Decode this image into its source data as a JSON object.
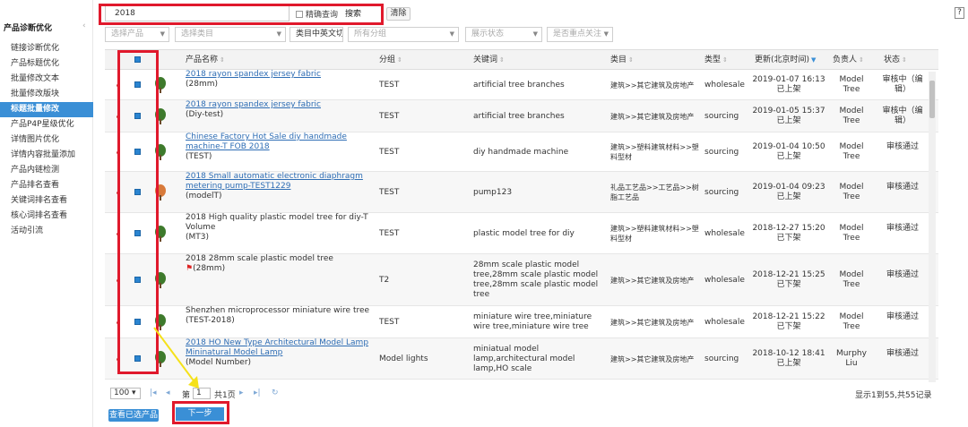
{
  "sidebar": {
    "title": "产品诊断优化",
    "collapse_icon": "chevron-left-icon",
    "items": [
      {
        "label": "链接诊断优化",
        "active": false
      },
      {
        "label": "产品标题优化",
        "active": false
      },
      {
        "label": "批量修改文本",
        "active": false
      },
      {
        "label": "批量修改版块",
        "active": false
      },
      {
        "label": "标题批量修改",
        "active": true
      },
      {
        "label": "产品P4P星级优化",
        "active": false
      },
      {
        "label": "详情图片优化",
        "active": false
      },
      {
        "label": "详情内容批量添加",
        "active": false
      },
      {
        "label": "产品内链检测",
        "active": false
      },
      {
        "label": "产品排名查看",
        "active": false
      },
      {
        "label": "关键词排名查看",
        "active": false
      },
      {
        "label": "核心词排名查看",
        "active": false
      },
      {
        "label": "活动引流",
        "active": false
      }
    ]
  },
  "search": {
    "value": "2018",
    "exact_label": "精确查询",
    "search_label": "搜索",
    "clear_label": "清除"
  },
  "help_label": "?",
  "filters": {
    "product": "选择产品",
    "category": "选择类目",
    "cut_label": "类目中英文切换",
    "group": "所有分组",
    "display": "展示状态",
    "focus": "是否重点关注"
  },
  "table": {
    "headers": {
      "name": "产品名称",
      "group": "分组",
      "keyword": "关键词",
      "category": "类目",
      "type": "类型",
      "updated": "更新(北京时间)",
      "owner": "负责人",
      "status": "状态"
    },
    "rows": [
      {
        "name": "2018 rayon spandex jersey fabric",
        "sub": "(28mm)",
        "link": true,
        "group": "TEST",
        "keyword": "artificial tree branches",
        "category": "建筑>>其它建筑及房地产",
        "type": "wholesale",
        "updated_date": "2019-01-07 16:13",
        "updated_state": "已上架",
        "owner": "Model Tree",
        "status": "审核中（编辑）"
      },
      {
        "name": "2018 rayon spandex jersey fabric",
        "sub": "(Diy-test)",
        "link": true,
        "group": "TEST",
        "keyword": "artificial tree branches",
        "category": "建筑>>其它建筑及房地产",
        "type": "sourcing",
        "updated_date": "2019-01-05 15:37",
        "updated_state": "已上架",
        "owner": "Model Tree",
        "status": "审核中（编辑）"
      },
      {
        "name": "Chinese Factory Hot Sale diy handmade machine-T FOB 2018",
        "sub": "(TEST)",
        "link": true,
        "group": "TEST",
        "keyword": "diy handmade machine",
        "category": "建筑>>塑料建筑材料>>塑料型材",
        "type": "sourcing",
        "updated_date": "2019-01-04 10:50",
        "updated_state": "已上架",
        "owner": "Model Tree",
        "status": "审核通过"
      },
      {
        "name": "2018 Small automatic electronic diaphragm metering pump-TEST1229",
        "sub": "(modelT)",
        "link": true,
        "group": "TEST",
        "keyword": "pump123",
        "category": "礼品工艺品>>工艺品>>树脂工艺品",
        "type": "sourcing",
        "updated_date": "2019-01-04 09:23",
        "updated_state": "已上架",
        "owner": "Model Tree",
        "status": "审核通过"
      },
      {
        "name": "2018 High quality plastic model tree for diy-T Volume",
        "sub": "(MT3)",
        "link": false,
        "group": "TEST",
        "keyword": "plastic model tree for diy",
        "category": "建筑>>塑料建筑材料>>塑料型材",
        "type": "wholesale",
        "updated_date": "2018-12-27 15:20",
        "updated_state": "已下架",
        "owner": "Model Tree",
        "status": "审核通过"
      },
      {
        "name": "2018 28mm scale plastic model tree",
        "sub": "(28mm)",
        "link": false,
        "flag": true,
        "group": "T2",
        "keyword": "28mm scale plastic model tree,28mm scale plastic model tree,28mm scale plastic model tree",
        "category": "建筑>>其它建筑及房地产",
        "type": "wholesale",
        "updated_date": "2018-12-21 15:25",
        "updated_state": "已下架",
        "owner": "Model Tree",
        "status": "审核通过"
      },
      {
        "name": "Shenzhen microprocessor miniature wire tree",
        "sub": "(TEST-2018)",
        "link": false,
        "group": "TEST",
        "keyword": "miniature wire tree,miniature wire tree,miniature wire tree",
        "category": "建筑>>其它建筑及房地产",
        "type": "wholesale",
        "updated_date": "2018-12-21 15:22",
        "updated_state": "已下架",
        "owner": "Model Tree",
        "status": "审核通过"
      },
      {
        "name": "2018 HO New Type Architectural Model Lamp Mininatural Model Lamp",
        "sub": "(Model Number)",
        "link": true,
        "group": "Model lights",
        "keyword": "miniatual model lamp,architectural model lamp,HO scale",
        "category": "建筑>>其它建筑及房地产",
        "type": "sourcing",
        "updated_date": "2018-10-12 18:41",
        "updated_state": "已上架",
        "owner": "Murphy Liu",
        "status": "审核通过"
      }
    ]
  },
  "pager": {
    "page_size": "100",
    "page_prefix": "第",
    "page_value": "1",
    "total_pages": "共1页",
    "summary": "显示1到55,共55记录"
  },
  "actions": {
    "view_selected": "查看已选产品",
    "next_step": "下一步"
  },
  "colors": {
    "accent": "#3a8fd6",
    "highlight": "#e0192c",
    "arrow": "#f5e11a",
    "link": "#2e6db4"
  }
}
